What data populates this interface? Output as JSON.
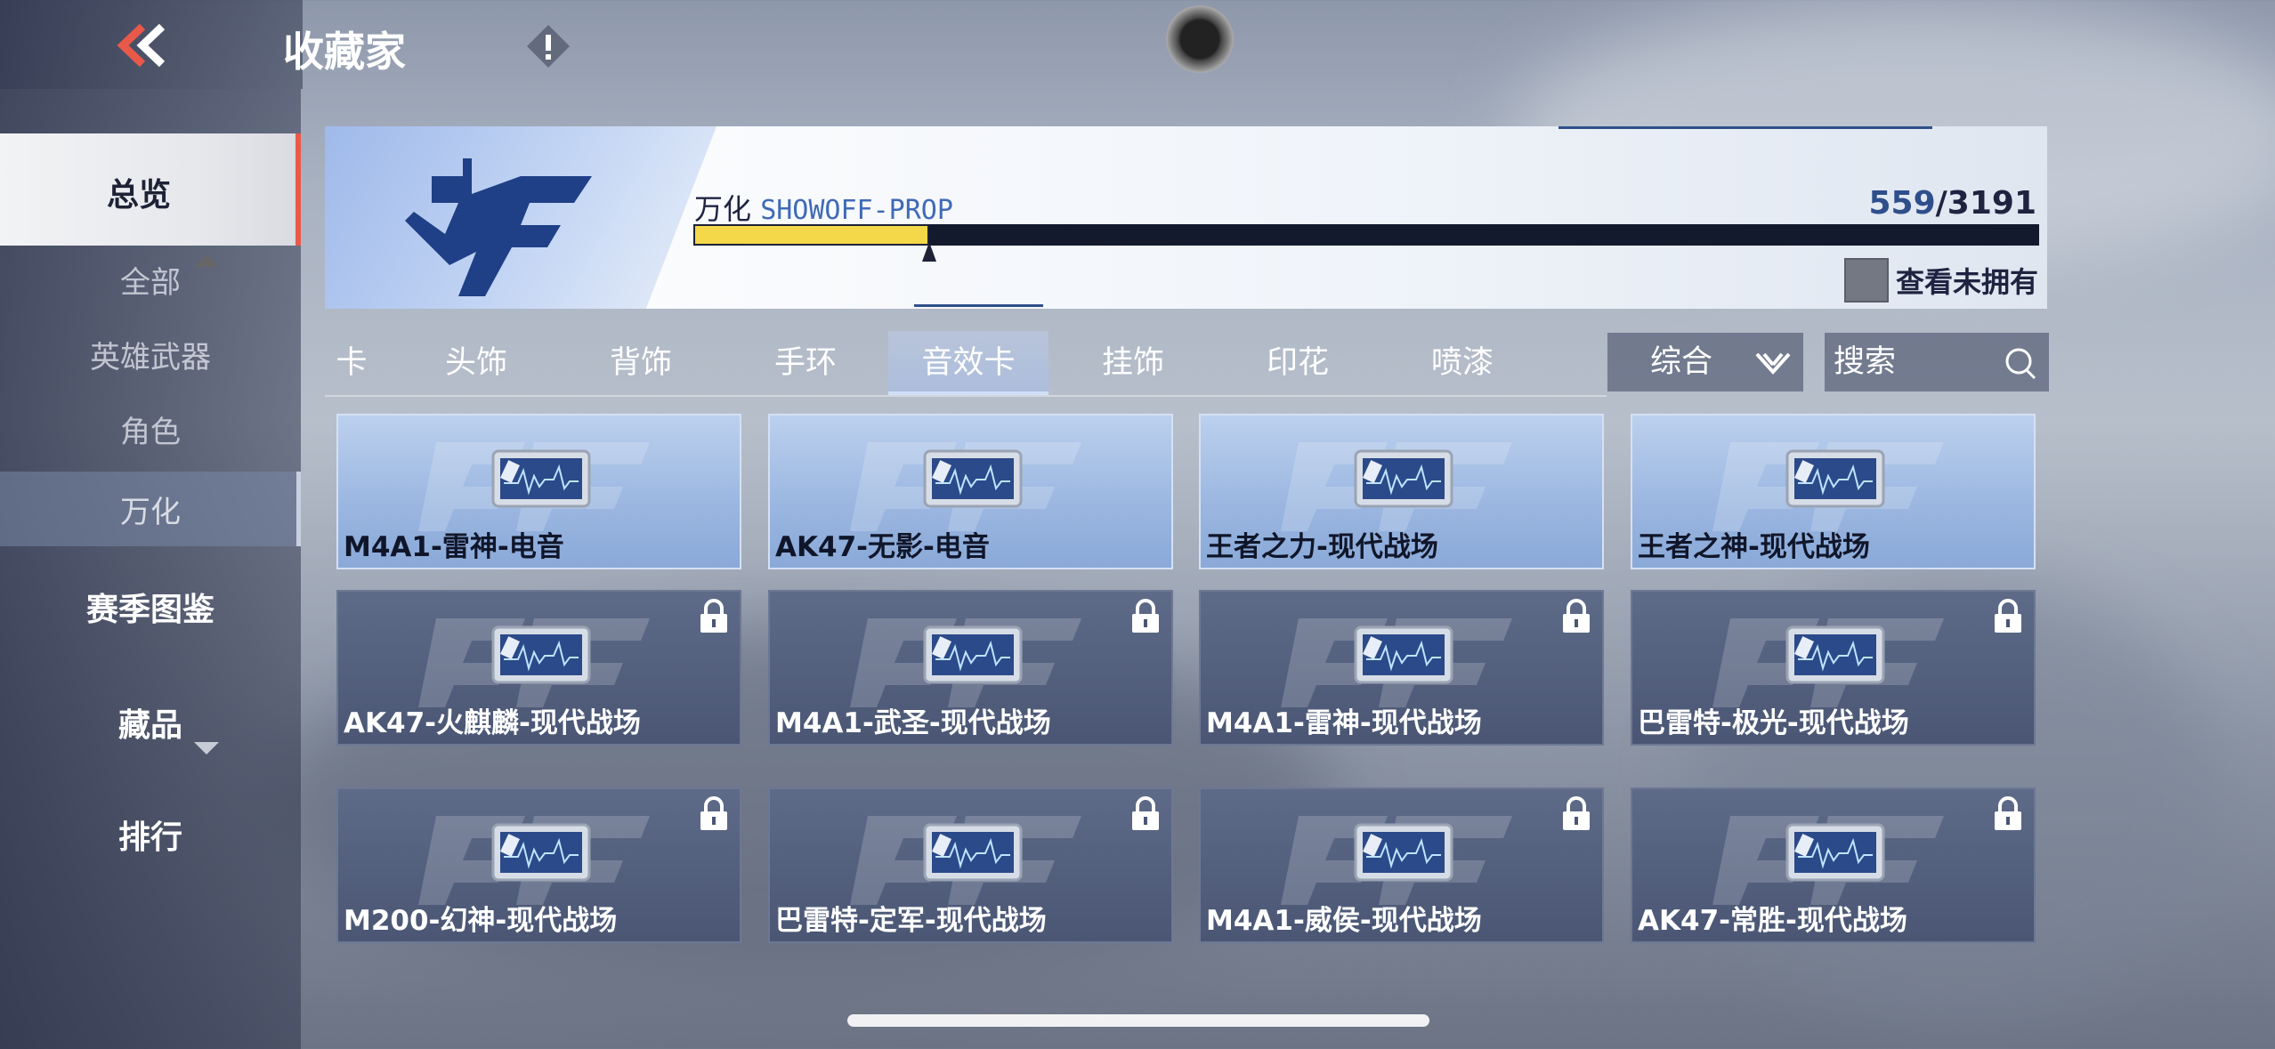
{
  "header": {
    "title": "收藏家"
  },
  "sidebar": {
    "items": [
      {
        "label": "总览"
      },
      {
        "label": "全部"
      },
      {
        "label": "英雄武器"
      },
      {
        "label": "角色"
      },
      {
        "label": "万化"
      },
      {
        "label": "赛季图鉴"
      },
      {
        "label": "藏品"
      },
      {
        "label": "排行"
      }
    ]
  },
  "banner": {
    "collection_cn": "万化",
    "collection_en": "SHOWOFF-PROP",
    "owned": "559",
    "separator": "/",
    "total": "3191",
    "progress_fraction": 0.175,
    "show_unowned_label": "查看未拥有"
  },
  "tabs": [
    {
      "label": "卡"
    },
    {
      "label": "头饰"
    },
    {
      "label": "背饰"
    },
    {
      "label": "手环"
    },
    {
      "label": "音效卡"
    },
    {
      "label": "挂饰"
    },
    {
      "label": "印花"
    },
    {
      "label": "喷漆"
    }
  ],
  "sort": {
    "value": "综合"
  },
  "search": {
    "placeholder": "搜索"
  },
  "cards": [
    {
      "name": "M4A1-雷神-电音",
      "locked": false
    },
    {
      "name": "AK47-无影-电音",
      "locked": false
    },
    {
      "name": "王者之力-现代战场",
      "locked": false
    },
    {
      "name": "王者之神-现代战场",
      "locked": false
    },
    {
      "name": "AK47-火麒麟-现代战场",
      "locked": true
    },
    {
      "name": "M4A1-武圣-现代战场",
      "locked": true
    },
    {
      "name": "M4A1-雷神-现代战场",
      "locked": true
    },
    {
      "name": "巴雷特-极光-现代战场",
      "locked": true
    },
    {
      "name": "M200-幻神-现代战场",
      "locked": true
    },
    {
      "name": "巴雷特-定军-现代战场",
      "locked": true
    },
    {
      "name": "M4A1-威侯-现代战场",
      "locked": true
    },
    {
      "name": "AK47-常胜-现代战场",
      "locked": true
    }
  ],
  "colors": {
    "accent_red": "#e8594a",
    "progress_yellow": "#f4d84a",
    "brand_blue": "#2f4f8c"
  }
}
